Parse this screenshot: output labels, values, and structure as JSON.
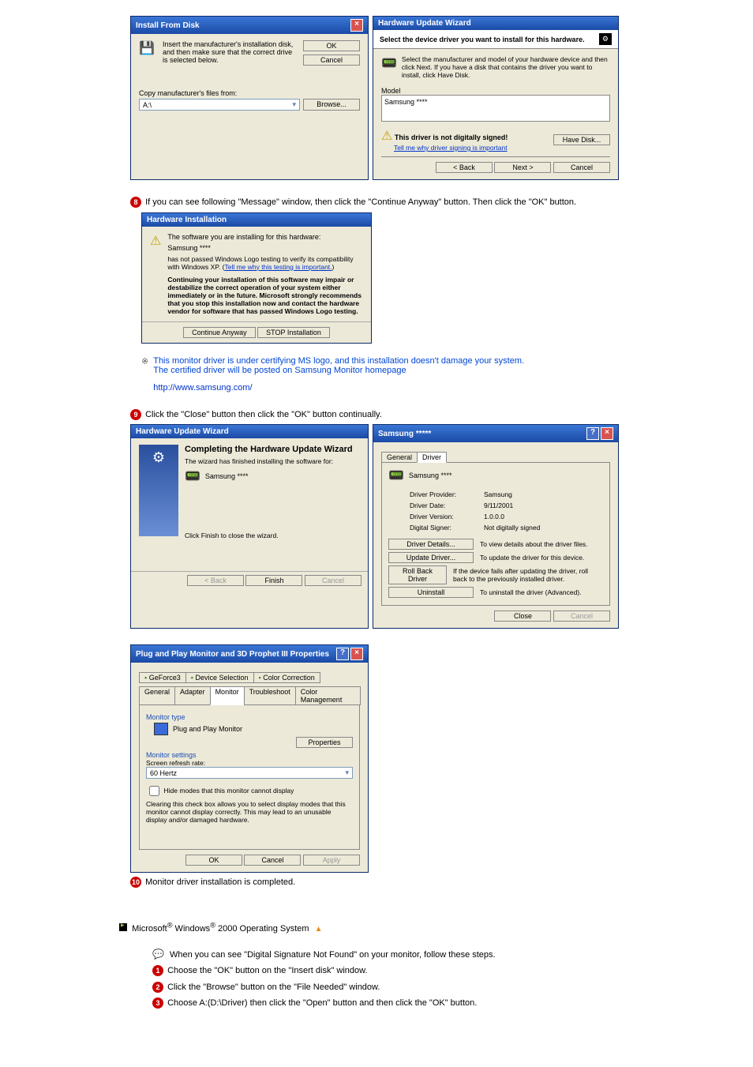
{
  "install_from_disk": {
    "title": "Install From Disk",
    "instruction": "Insert the manufacturer's installation disk, and then make sure that the correct drive is selected below.",
    "ok": "OK",
    "cancel": "Cancel",
    "copy_label": "Copy manufacturer's files from:",
    "path_value": "A:\\",
    "browse": "Browse..."
  },
  "hw_wizard_select": {
    "title": "Hardware Update Wizard",
    "heading": "Select the device driver you want to install for this hardware.",
    "instruction": "Select the manufacturer and model of your hardware device and then click Next. If you have a disk that contains the driver you want to install, click Have Disk.",
    "model_label": "Model",
    "model_value": "Samsung ****",
    "warn_text": "This driver is not digitally signed!",
    "tell_me": "Tell me why driver signing is important",
    "have_disk": "Have Disk...",
    "back": "< Back",
    "next": "Next >",
    "cancel": "Cancel"
  },
  "step8_text": "If you can see following \"Message\" window, then click the \"Continue Anyway\" button. Then click the \"OK\" button.",
  "hw_installation": {
    "title": "Hardware Installation",
    "line1": "The software you are installing for this hardware:",
    "device": "Samsung ****",
    "line2": "has not passed Windows Logo testing to verify its compatibility with Windows XP. (",
    "tell_me": "Tell me why this testing is important.",
    "line2_end": ")",
    "bold_text": "Continuing your installation of this software may impair or destabilize the correct operation of your system either immediately or in the future. Microsoft strongly recommends that you stop this installation now and contact the hardware vendor for software that has passed Windows Logo testing.",
    "continue": "Continue Anyway",
    "stop": "STOP Installation"
  },
  "note_cert": {
    "line1": "This monitor driver is under certifying MS logo, and this installation doesn't damage your system.",
    "line2": "The certified driver will be posted on Samsung Monitor homepage",
    "link": "http://www.samsung.com/"
  },
  "step9_text": "Click the \"Close\" button then click the \"OK\" button continually.",
  "complete_wizard": {
    "title": "Hardware Update Wizard",
    "heading": "Completing the Hardware Update Wizard",
    "sub": "The wizard has finished installing the software for:",
    "device": "Samsung ****",
    "instruction": "Click Finish to close the wizard.",
    "back": "< Back",
    "finish": "Finish",
    "cancel": "Cancel"
  },
  "props": {
    "title": "Samsung *****",
    "tab_general": "General",
    "tab_driver": "Driver",
    "device": "Samsung ****",
    "provider_label": "Driver Provider:",
    "provider": "Samsung",
    "date_label": "Driver Date:",
    "date": "9/11/2001",
    "version_label": "Driver Version:",
    "version": "1.0.0.0",
    "signer_label": "Digital Signer:",
    "signer": "Not digitally signed",
    "btn_details": "Driver Details...",
    "txt_details": "To view details about the driver files.",
    "btn_update": "Update Driver...",
    "txt_update": "To update the driver for this device.",
    "btn_rollback": "Roll Back Driver",
    "txt_rollback": "If the device fails after updating the driver, roll back to the previously installed driver.",
    "btn_uninstall": "Uninstall",
    "txt_uninstall": "To uninstall the driver (Advanced).",
    "close": "Close",
    "cancel": "Cancel"
  },
  "display_props": {
    "title": "Plug and Play Monitor and 3D Prophet III Properties",
    "tab_geforce": "GeForce3",
    "tab_device_sel": "Device Selection",
    "tab_color_corr": "Color Correction",
    "tab_general": "General",
    "tab_adapter": "Adapter",
    "tab_monitor": "Monitor",
    "tab_trouble": "Troubleshoot",
    "tab_colormgmt": "Color Management",
    "group_type": "Monitor type",
    "monitor_name": "Plug and Play Monitor",
    "properties": "Properties",
    "group_settings": "Monitor settings",
    "refresh_label": "Screen refresh rate:",
    "refresh_value": "60 Hertz",
    "hide_checkbox": "Hide modes that this monitor cannot display",
    "hide_desc": "Clearing this check box allows you to select display modes that this monitor cannot display correctly. This may lead to an unusable display and/or damaged hardware.",
    "ok": "OK",
    "cancel": "Cancel",
    "apply": "Apply"
  },
  "step10_text": "Monitor driver installation is completed.",
  "win2000_heading": "Microsoft® Windows® 2000 Operating System",
  "win2000_intro": "When you can see \"Digital Signature Not Found\" on your monitor, follow these steps.",
  "win2000_steps": {
    "s1": "Choose the \"OK\" button on the \"Insert disk\" window.",
    "s2": "Click the \"Browse\" button on the \"File Needed\" window.",
    "s3": "Choose A:(D:\\Driver) then click the \"Open\" button and then click the \"OK\" button."
  }
}
